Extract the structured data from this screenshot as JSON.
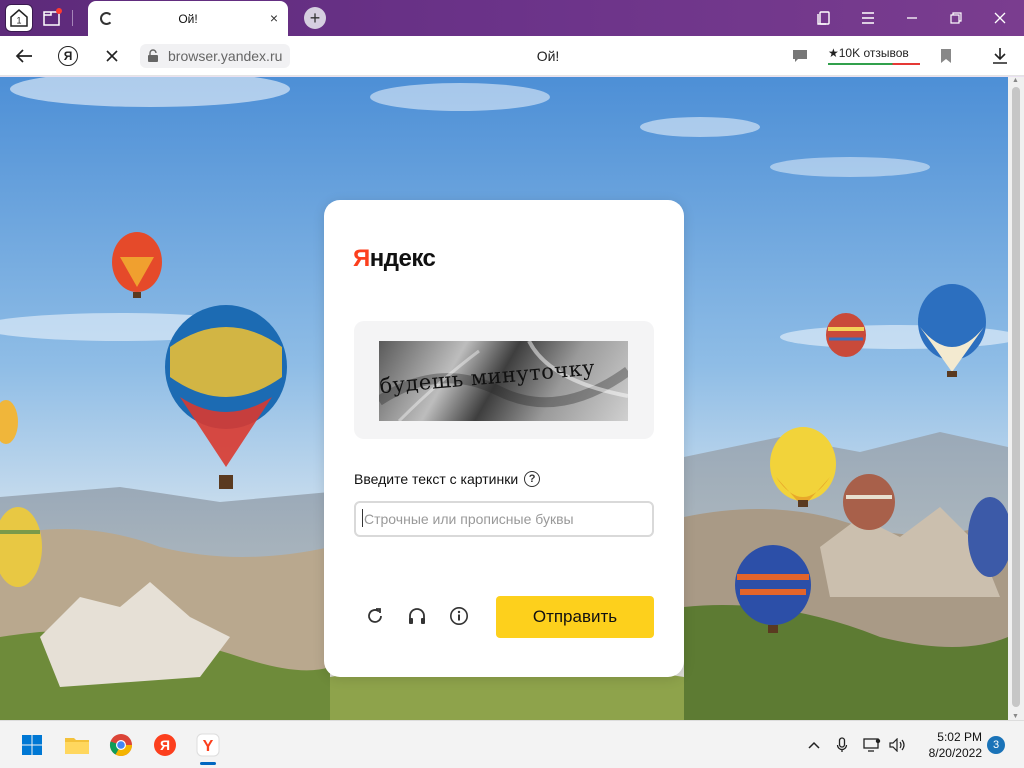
{
  "tabstrip": {
    "home_badge": "1",
    "tab_title": "Ой!",
    "tab_close": "×",
    "new_tab": "+"
  },
  "addressbar": {
    "url": "browser.yandex.ru",
    "page_title": "Ой!",
    "reviews": "★10K отзывов"
  },
  "captcha": {
    "brand": "Яндекс",
    "brand_first": "Я",
    "brand_rest": "ндекс",
    "image_text": "будешь минуточку",
    "label": "Введите текст с картинки",
    "help": "?",
    "input_placeholder": "Строчные или прописные буквы",
    "submit_label": "Отправить"
  },
  "taskbar": {
    "time": "5:02 PM",
    "date": "8/20/2022",
    "notifications": "3"
  },
  "colors": {
    "accent_yellow": "#fdd01c",
    "yandex_red": "#fc3f1d",
    "tabstrip": "#6b3389"
  },
  "icons": [
    "home-icon",
    "tabs-icon",
    "loading-icon",
    "close-icon",
    "plus-icon",
    "collections-icon",
    "menu-icon",
    "minimize-icon",
    "restore-icon",
    "back-icon",
    "yandex-icon",
    "stop-icon",
    "lock-icon",
    "chat-icon",
    "bookmark-icon",
    "download-icon",
    "refresh-icon",
    "audio-icon",
    "info-icon",
    "windows-icon",
    "folder-icon",
    "chrome-icon",
    "yandex-app-icon",
    "yandex-browser-icon",
    "chevron-up-icon",
    "mic-icon",
    "monitor-icon",
    "volume-icon"
  ]
}
